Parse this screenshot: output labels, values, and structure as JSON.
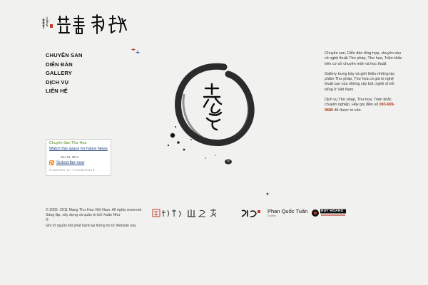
{
  "nav": {
    "items": [
      "Chuyên san",
      "Diễn đàn",
      "Gallery",
      "Dịch vụ",
      "Liên hệ"
    ]
  },
  "right_text": {
    "p1": "Chuyên san, Diễn đàn tổng hợp, chuyên sâu về nghệ thuật Thư pháp, Thư họa, Triện khắc trên cơ sở chuyên môn và học thuật",
    "p2": "Gallery trưng bày và giới thiệu những tác phẩm Thư pháp, Thư họa có giá trị nghệ thuật cao của những cây bút, nghệ sĩ nổi tiếng ở Việt Nam",
    "p3_main": "Dịch vụ Thư pháp, Thư họa, Triện khắc chuyên nghiệp. Hãy gọi điện số ",
    "p3_phone": "093-699-9680",
    "p3_tail": " để được tư vấn"
  },
  "feed": {
    "title": "Chuyên San Thư Họa",
    "post": "Watch this space for future News",
    "date": "Dec 16, 2014",
    "subscribe": "Subscribe now",
    "powered": "POWERED BY FEEDBURNER"
  },
  "footer": {
    "line1": "© 2005 -2011 Mạng Thư Họa Việt Nam. All rights reserved",
    "line2": "Sáng lập, xây dựng và quản trị bởi Xuân Như",
    "line3": "Ghi rõ nguồn khi phát hành lại thông tin từ Website này"
  },
  "partners": {
    "name": "Phan Quốc Tuấn",
    "name_sub": "Gallery",
    "brand": "HUY HOANG"
  },
  "colors": {
    "background": "#f1f1ef",
    "ink": "#111111",
    "phone": "#b0351c",
    "feed_title": "#4f8a10",
    "link": "#1f3f7a",
    "rss": "#f08a24",
    "seal_red": "#c0392b"
  }
}
